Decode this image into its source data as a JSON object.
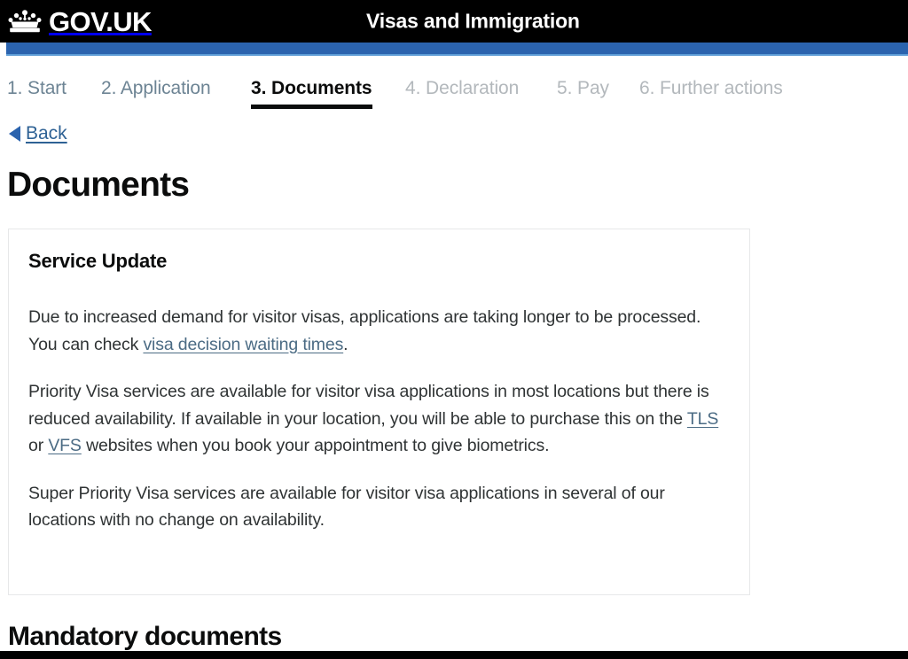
{
  "header": {
    "brand": "GOV.UK",
    "crown_icon": "crown-icon",
    "service_name": "Visas and Immigration",
    "accent_blue": "#2b63ae",
    "background": "#000000"
  },
  "steps": [
    {
      "label": "1. Start",
      "state": "completed"
    },
    {
      "label": "2. Application",
      "state": "completed"
    },
    {
      "label": "3. Documents",
      "state": "current"
    },
    {
      "label": "4. Declaration",
      "state": "upcoming"
    },
    {
      "label": "5. Pay",
      "state": "upcoming"
    },
    {
      "label": "6. Further actions",
      "state": "upcoming"
    }
  ],
  "back": {
    "label": "Back",
    "icon": "back-arrow-icon"
  },
  "page": {
    "title": "Documents"
  },
  "service_update": {
    "title": "Service Update",
    "paragraph_1": {
      "before_link": "Due to increased demand for visitor visas, applications are taking longer to be processed. You can check ",
      "link": "visa decision waiting times",
      "after_link": "."
    },
    "paragraph_2": {
      "before_link_1": "Priority Visa services are available for visitor visa applications in most locations but there is reduced availability. If available in your location, you will be able to purchase this on the ",
      "link_1": "TLS",
      "between_links": " or ",
      "link_2": "VFS",
      "after_link_2": " websites when you book your appointment to give biometrics."
    },
    "paragraph_3": "Super Priority Visa services are available for visitor visa applications in several of our locations with no change on availability."
  },
  "mandatory_documents": {
    "heading": "Mandatory documents"
  }
}
